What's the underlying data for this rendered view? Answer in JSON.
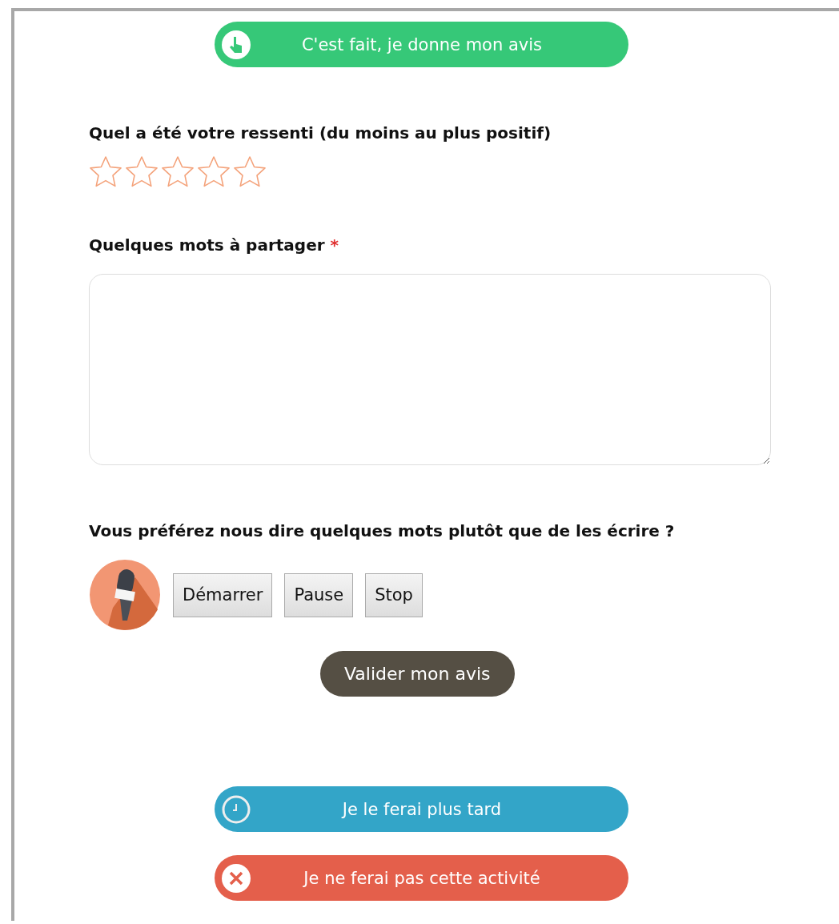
{
  "top_action": {
    "kind": "done",
    "label": "C'est fait, je donne mon avis",
    "color": "#36c878"
  },
  "rating": {
    "label": "Quel a été votre ressenti (du moins au plus positif)",
    "stars": 0
  },
  "comment": {
    "label": "Quelques mots à partager",
    "required": true,
    "required_mark": "*"
  },
  "voice": {
    "label": "Vous préférez nous dire quelques mots plutôt que de les écrire ?",
    "buttons": [
      "Démarrer",
      "Pause",
      "Stop"
    ]
  },
  "submit": {
    "label": "Valider mon avis"
  },
  "other_actions": [
    {
      "kind": "later",
      "label": "Je le ferai plus tard",
      "color": "#33a5c8"
    },
    {
      "kind": "skip",
      "label": "Je ne ferai pas cette activité",
      "color": "#e45f4b"
    }
  ]
}
